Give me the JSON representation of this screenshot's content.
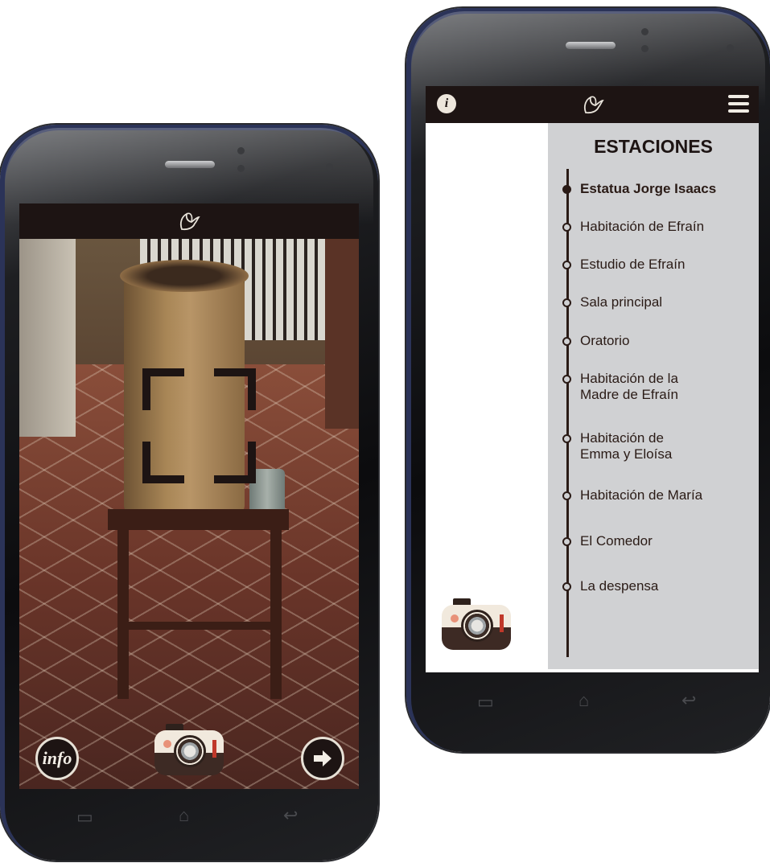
{
  "left_screen": {
    "logo_icon": "dove-logo-icon",
    "info_button_label": "info",
    "next_icon": "arrow-right-icon",
    "camera_icon": "camera-icon"
  },
  "right_screen": {
    "info_badge_label": "i",
    "logo_icon": "dove-logo-icon",
    "menu_icon": "hamburger-menu-icon",
    "stations_title": "ESTACIONES",
    "stations": [
      {
        "label": "Estatua Jorge Isaacs",
        "active": true
      },
      {
        "label": "Habitación de Efraín",
        "active": false
      },
      {
        "label": "Estudio de Efraín",
        "active": false
      },
      {
        "label": "Sala principal",
        "active": false
      },
      {
        "label": "Oratorio",
        "active": false
      },
      {
        "label": "Habitación de la Madre de Efraín",
        "active": false
      },
      {
        "label": "Habitación de Emma y Eloísa",
        "active": false
      },
      {
        "label": "Habitación de María",
        "active": false
      },
      {
        "label": "El Comedor",
        "active": false
      },
      {
        "label": "La despensa",
        "active": false
      }
    ],
    "camera_icon": "camera-icon"
  },
  "colors": {
    "bar": "#1d1413",
    "panel": "#d0d1d3",
    "accent_red": "#c0382a"
  }
}
